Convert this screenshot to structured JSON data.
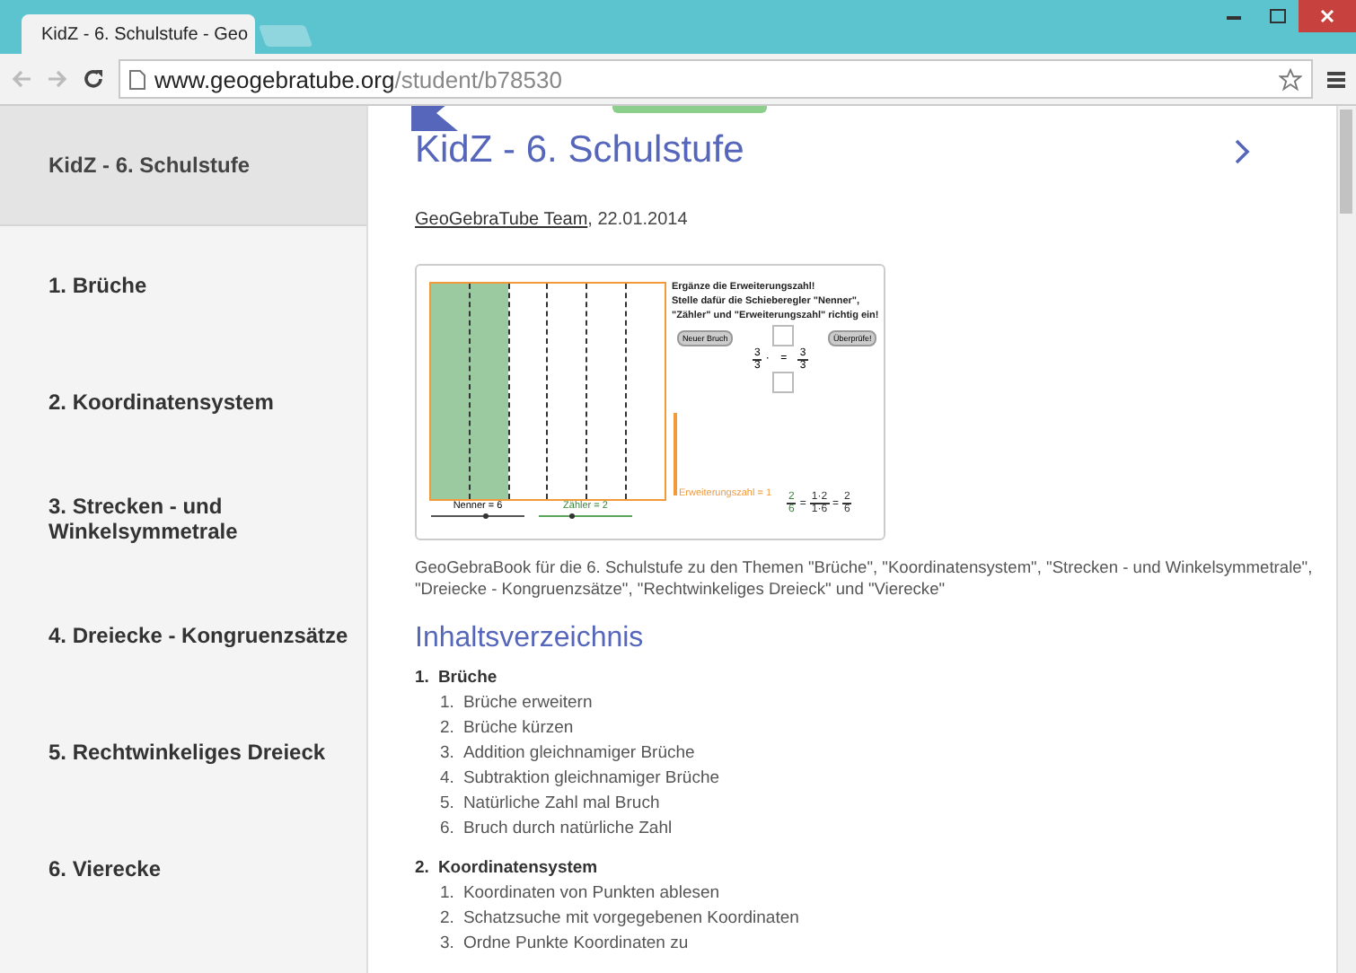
{
  "window": {
    "tab_title": "KidZ - 6. Schulstufe - Geo",
    "url_host": "www.geogebratube.org",
    "url_path": "/student/b78530"
  },
  "sidebar": {
    "title": "KidZ - 6. Schulstufe",
    "items": [
      {
        "label": "1. Brüche"
      },
      {
        "label": "2. Koordinatensystem"
      },
      {
        "label": "3. Strecken - und Winkelsymmetrale"
      },
      {
        "label": "4. Dreiecke - Kongruenzsätze"
      },
      {
        "label": "5. Rechtwinkeliges Dreieck"
      },
      {
        "label": "6. Vierecke"
      }
    ]
  },
  "main": {
    "title": "KidZ - 6. Schulstufe",
    "author": "GeoGebraTube Team",
    "date": ", 22.01.2014",
    "applet": {
      "columns": [
        {
          "shaded": true
        },
        {
          "shaded": true
        },
        {
          "shaded": false
        },
        {
          "shaded": false
        },
        {
          "shaded": false
        },
        {
          "shaded": false
        }
      ],
      "instructions": [
        "Ergänze die Erweiterungszahl!",
        "Stelle dafür die Schieberegler \"Nenner\",",
        "\"Zähler\" und \"Erweiterungszahl\" richtig ein!"
      ],
      "buttons": [
        "Neuer Bruch",
        "Überprüfe!"
      ],
      "task": {
        "left": {
          "num": "3",
          "den": "3"
        },
        "dot": "·",
        "operator": "=",
        "right": {
          "num": "3",
          "den": "3"
        }
      },
      "sliders": [
        {
          "label": "Nenner = 6",
          "level": 0.6
        },
        {
          "label": "Zähler = 2",
          "level": 0.35
        }
      ],
      "factor_label": "Erweiterungszahl = 1",
      "result": {
        "fractions": [
          {
            "num": "2",
            "den": "6"
          },
          {
            "num": "1·2",
            "den": "1·6"
          },
          {
            "num": "2",
            "den": "6"
          }
        ],
        "operator": "="
      }
    },
    "description": "GeoGebraBook für die 6. Schulstufe zu den Themen \"Brüche\", \"Koordinatensystem\", \"Strecken - und Winkelsymmetrale\", \"Dreiecke - Kongruenzsätze\", \"Rechtwinkeliges Dreieck\" und \"Vierecke\"",
    "toc_heading": "Inhaltsverzeichnis",
    "toc": [
      {
        "number": "1.",
        "label": "Brüche",
        "children": [
          {
            "number": "1.",
            "label": "Brüche erweitern"
          },
          {
            "number": "2.",
            "label": "Brüche kürzen"
          },
          {
            "number": "3.",
            "label": "Addition gleichnamiger Brüche"
          },
          {
            "number": "4.",
            "label": "Subtraktion gleichnamiger Brüche"
          },
          {
            "number": "5.",
            "label": "Natürliche Zahl mal Bruch"
          },
          {
            "number": "6.",
            "label": "Bruch durch natürliche Zahl"
          }
        ]
      },
      {
        "number": "2.",
        "label": "Koordinatensystem",
        "children": [
          {
            "number": "1.",
            "label": "Koordinaten von Punkten ablesen"
          },
          {
            "number": "2.",
            "label": "Schatzsuche mit vorgegebenen Koordinaten"
          },
          {
            "number": "3.",
            "label": "Ordne Punkte Koordinaten zu"
          }
        ]
      }
    ]
  }
}
